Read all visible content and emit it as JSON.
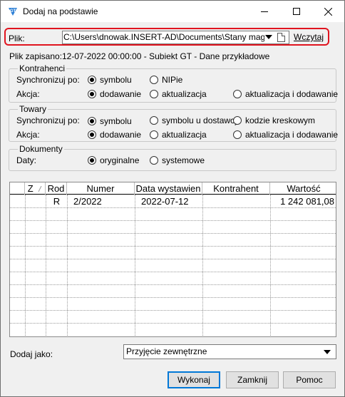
{
  "window": {
    "title": "Dodaj na podstawie",
    "app_icon_text": "GT",
    "minimize_icon": "minimize-icon",
    "maximize_icon": "maximize-icon",
    "close_icon": "close-icon"
  },
  "file": {
    "label": "Plik:",
    "path": "C:\\Users\\dnowak.INSERT-AD\\Documents\\Stany magazyn",
    "load_link": "Wczytaj",
    "saved_label": "Plik zapisano:",
    "saved_value": "12-07-2022 00:00:00 - Subiekt GT - Dane przykładowe"
  },
  "contractors": {
    "title": "Kontrahenci",
    "sync_label": "Synchronizuj po:",
    "sync_options": [
      "symbolu",
      "NIPie"
    ],
    "sync_selected": 0,
    "action_label": "Akcja:",
    "action_options": [
      "dodawanie",
      "aktualizacja",
      "aktualizacja i dodawanie"
    ],
    "action_selected": 0
  },
  "goods": {
    "title": "Towary",
    "sync_label": "Synchronizuj po:",
    "sync_options": [
      "symbolu",
      "symbolu u dostawcy",
      "kodzie kreskowym"
    ],
    "sync_selected": 0,
    "action_label": "Akcja:",
    "action_options": [
      "dodawanie",
      "aktualizacja",
      "aktualizacja i dodawanie"
    ],
    "action_selected": 0
  },
  "documents": {
    "title": "Dokumenty",
    "dates_label": "Daty:",
    "dates_options": [
      "oryginalne",
      "systemowe"
    ],
    "dates_selected": 0
  },
  "table": {
    "columns": [
      "",
      "Z",
      "Rod",
      "Numer",
      "Data wystawien",
      "Kontrahent",
      "Wartość"
    ],
    "rows": [
      {
        "z": "",
        "rod": "R",
        "numer": "2/2022",
        "data": "2022-07-12",
        "kontrahent": "",
        "wartosc": "1 242 081,08"
      }
    ]
  },
  "add_as": {
    "label": "Dodaj jako:",
    "value": "Przyjęcie zewnętrzne"
  },
  "buttons": {
    "execute": "Wykonaj",
    "close": "Zamknij",
    "help": "Pomoc"
  }
}
